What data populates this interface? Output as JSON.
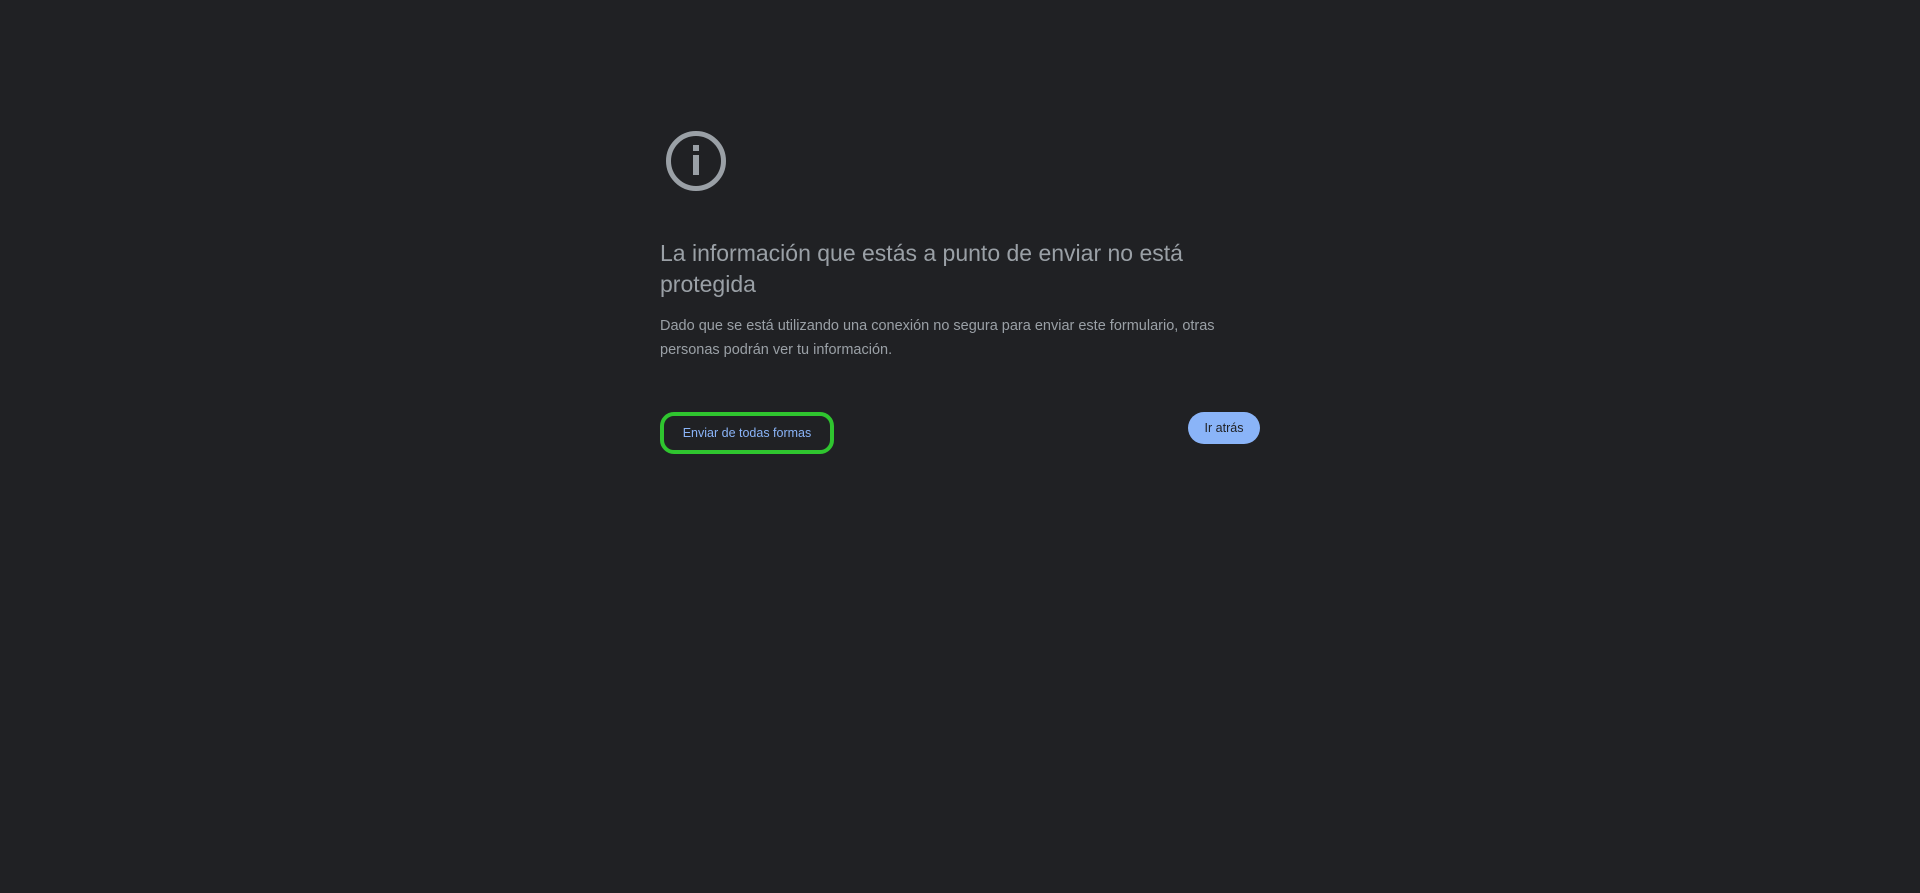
{
  "interstitial": {
    "icon": "info-circle-icon",
    "title": "La información que estás a punto de enviar no está protegida",
    "description": "Dado que se está utilizando una conexión no segura para enviar este formulario, otras personas podrán ver tu información.",
    "proceed_label": "Enviar de todas formas",
    "back_label": "Ir atrás"
  },
  "colors": {
    "background": "#202124",
    "text": "#9aa0a6",
    "link": "#8ab4f8",
    "primary_button": "#8ab4f8",
    "highlight": "#2fc52f"
  }
}
